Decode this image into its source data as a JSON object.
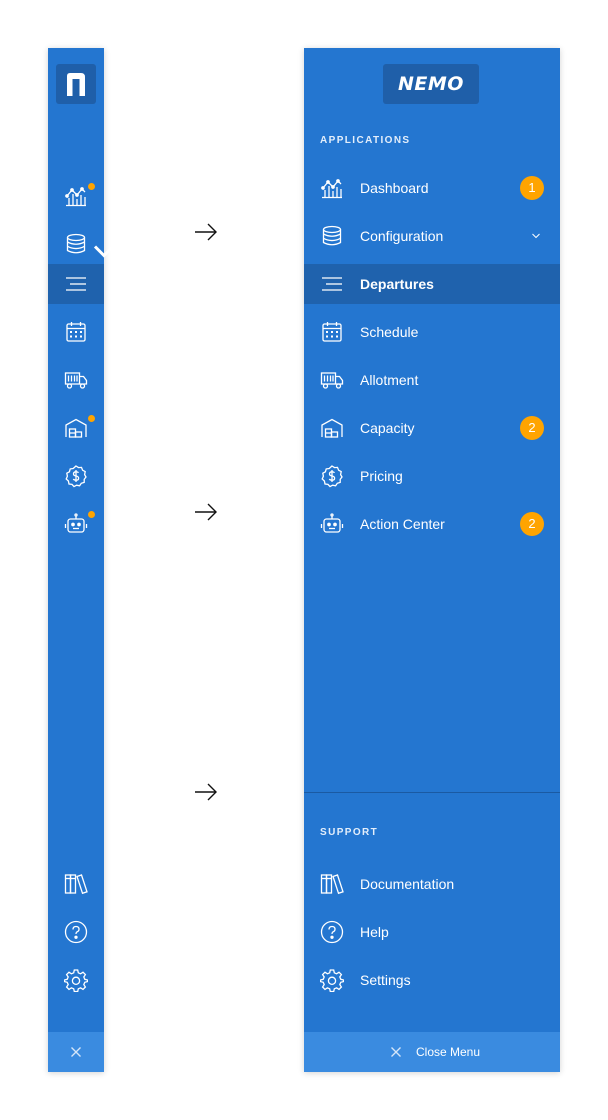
{
  "brand": {
    "logo_text": "NEMO",
    "mark_icon": "n-logo-icon"
  },
  "sections": {
    "applications": "APPLICATIONS",
    "support": "SUPPORT"
  },
  "nav": {
    "dashboard": {
      "label": "Dashboard",
      "badge": "1",
      "icon": "chart-icon"
    },
    "configuration": {
      "label": "Configuration",
      "icon": "database-icon"
    },
    "departures": {
      "label": "Departures",
      "icon": "list-icon"
    },
    "schedule": {
      "label": "Schedule",
      "icon": "calendar-icon"
    },
    "allotment": {
      "label": "Allotment",
      "icon": "truck-icon"
    },
    "capacity": {
      "label": "Capacity",
      "badge": "2",
      "icon": "warehouse-icon"
    },
    "pricing": {
      "label": "Pricing",
      "icon": "dollar-icon"
    },
    "action_center": {
      "label": "Action Center",
      "badge": "2",
      "icon": "robot-icon"
    }
  },
  "support": {
    "documentation": {
      "label": "Documentation",
      "icon": "books-icon"
    },
    "help": {
      "label": "Help",
      "icon": "help-icon"
    },
    "settings": {
      "label": "Settings",
      "icon": "gear-icon"
    }
  },
  "footer": {
    "close_label": "Close Menu"
  },
  "colors": {
    "sidebar_bg": "#2476d0",
    "active_bg": "#1f62ad",
    "logo_bg": "#1f5fa9",
    "footer_bg": "#3a8be0",
    "badge": "#ffa400",
    "text": "#ffffff"
  }
}
